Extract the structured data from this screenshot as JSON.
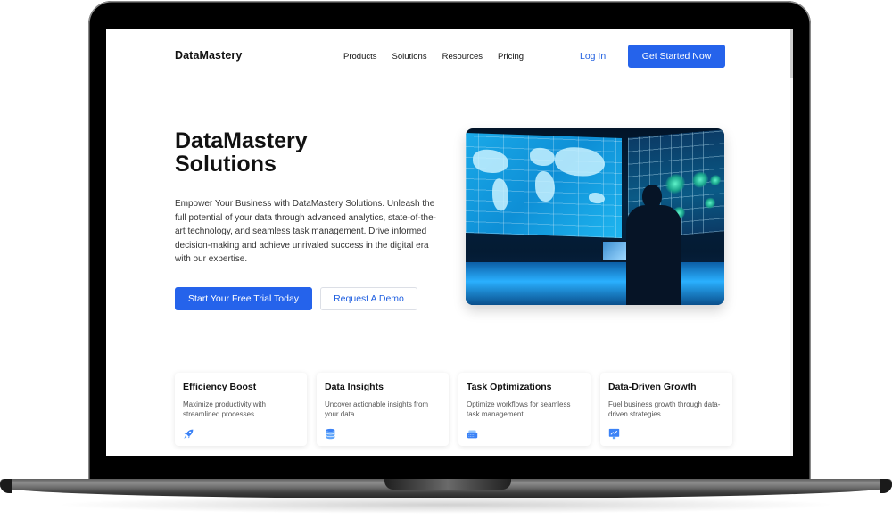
{
  "header": {
    "logo": "DataMastery",
    "nav": [
      {
        "label": "Products"
      },
      {
        "label": "Solutions"
      },
      {
        "label": "Resources"
      },
      {
        "label": "Pricing"
      }
    ],
    "login_label": "Log In",
    "cta_label": "Get Started Now"
  },
  "hero": {
    "title_line1": "DataMastery",
    "title_line2": "Solutions",
    "description": "Empower Your Business with DataMastery Solutions. Unleash the full potential of your data through advanced analytics, state-of-the-art technology, and seamless task management. Drive informed decision-making and achieve unrivaled success in the digital era with our expertise.",
    "primary_button": "Start Your Free Trial Today",
    "secondary_button": "Request A Demo",
    "image_alt": "Person standing in front of a large blue world map data display wall"
  },
  "features": [
    {
      "title": "Efficiency Boost",
      "text": "Maximize productivity with streamlined processes.",
      "icon": "rocket-icon"
    },
    {
      "title": "Data Insights",
      "text": "Uncover actionable insights from your data.",
      "icon": "database-icon"
    },
    {
      "title": "Task Optimizations",
      "text": "Optimize workflows for seamless task management.",
      "icon": "keyboard-icon"
    },
    {
      "title": "Data-Driven Growth",
      "text": "Fuel business growth through data-driven strategies.",
      "icon": "presentation-chart-icon"
    }
  ],
  "colors": {
    "accent": "#2563eb",
    "link": "#1f5fe0",
    "icon": "#3b82f6"
  }
}
